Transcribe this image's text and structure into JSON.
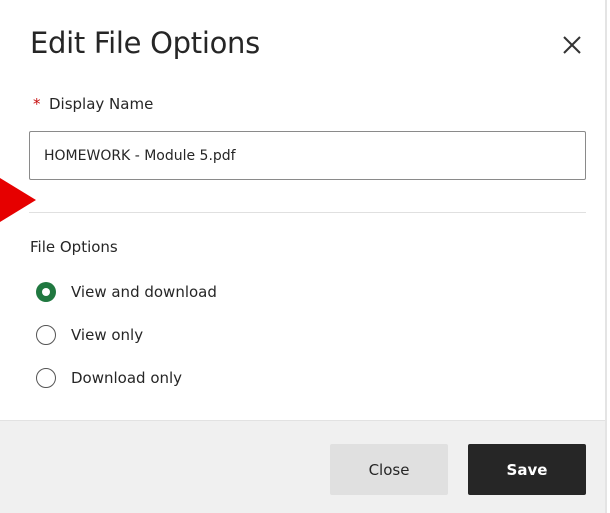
{
  "dialog": {
    "title": "Edit File Options",
    "close_icon": "close-icon"
  },
  "display_name": {
    "required_marker": "*",
    "label": "Display Name",
    "value": "HOMEWORK - Module 5.pdf"
  },
  "file_options": {
    "label": "File Options",
    "selected": "View and download",
    "options": [
      {
        "label": "View and download",
        "selected": true
      },
      {
        "label": "View only",
        "selected": false
      },
      {
        "label": "Download only",
        "selected": false
      }
    ]
  },
  "footer": {
    "close_label": "Close",
    "save_label": "Save"
  },
  "colors": {
    "selected_radio": "#207840",
    "primary_button": "#262626",
    "secondary_button": "#e0e0e0",
    "required": "#c60c0c",
    "annotation_arrow": "#e60000"
  }
}
